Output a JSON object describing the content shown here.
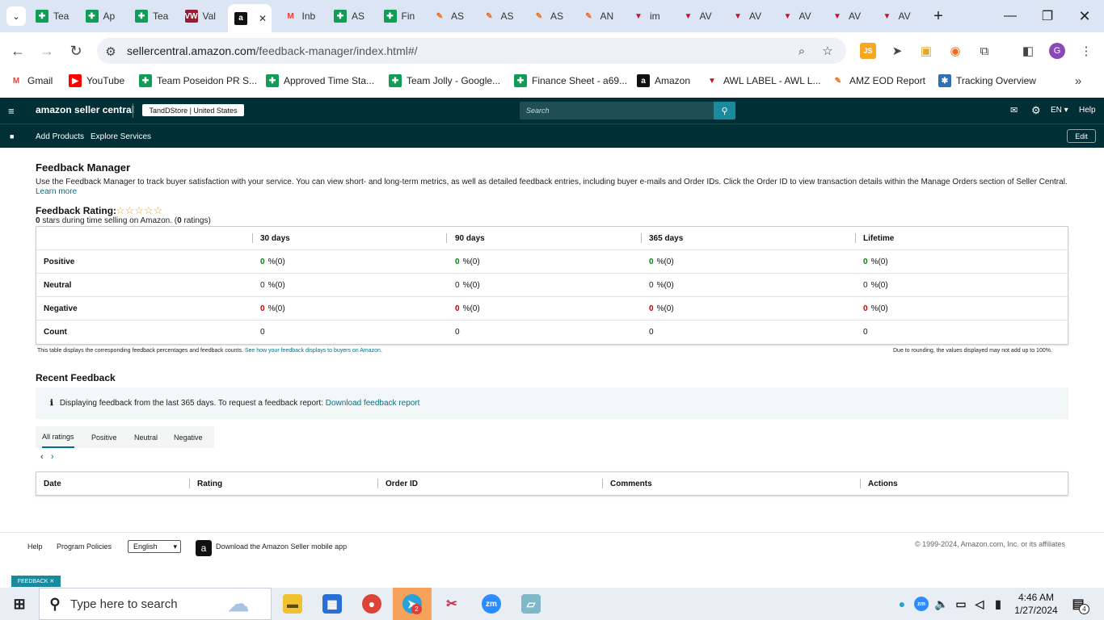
{
  "browser": {
    "tabs": [
      {
        "label": "Tea",
        "icon": "sheets-icon",
        "color": "#0f9d58"
      },
      {
        "label": "Ap",
        "icon": "sheets-icon",
        "color": "#0f9d58"
      },
      {
        "label": "Tea",
        "icon": "sheets-icon",
        "color": "#0f9d58"
      },
      {
        "label": "Val",
        "icon": "vw-icon",
        "color": "#9b1c31"
      },
      {
        "label": "",
        "icon": "amazon-icon",
        "color": "#111111"
      },
      {
        "label": "Inb",
        "icon": "gmail-icon",
        "color": "#ea4335"
      },
      {
        "label": "AS",
        "icon": "sheets-icon",
        "color": "#0f9d58"
      },
      {
        "label": "Fin",
        "icon": "sheets-icon",
        "color": "#0f9d58"
      },
      {
        "label": "AS",
        "icon": "pencil-icon",
        "color": "#f26b1d"
      },
      {
        "label": "AS",
        "icon": "pencil-icon",
        "color": "#f26b1d"
      },
      {
        "label": "AS",
        "icon": "pencil-icon",
        "color": "#f26b1d"
      },
      {
        "label": "AN",
        "icon": "pencil-icon",
        "color": "#f26b1d"
      },
      {
        "label": "im",
        "icon": "awl-icon",
        "color": "#c8102e"
      },
      {
        "label": "AV",
        "icon": "awl-icon",
        "color": "#c8102e"
      },
      {
        "label": "AV",
        "icon": "awl-icon",
        "color": "#c8102e"
      },
      {
        "label": "AV",
        "icon": "awl-icon",
        "color": "#c8102e"
      },
      {
        "label": "AV",
        "icon": "awl-icon",
        "color": "#c8102e"
      },
      {
        "label": "AV",
        "icon": "awl-icon",
        "color": "#c8102e"
      }
    ],
    "url_host": "sellercentral.amazon.com",
    "url_path": "/feedback-manager/index.html#/",
    "profile_initial": "G",
    "bookmarks": [
      {
        "label": "Gmail",
        "icon": "gmail-icon",
        "color": "#ea4335"
      },
      {
        "label": "YouTube",
        "icon": "youtube-icon",
        "color": "#ff0000"
      },
      {
        "label": "Team Poseidon PR S...",
        "icon": "sheets-icon",
        "color": "#0f9d58"
      },
      {
        "label": "Approved Time Sta...",
        "icon": "sheets-icon",
        "color": "#0f9d58"
      },
      {
        "label": "Team Jolly - Google...",
        "icon": "sheets-icon",
        "color": "#0f9d58"
      },
      {
        "label": "Finance Sheet - a69...",
        "icon": "sheets-icon",
        "color": "#0f9d58"
      },
      {
        "label": "Amazon",
        "icon": "amazon-icon",
        "color": "#111111"
      },
      {
        "label": "AWL LABEL - AWL L...",
        "icon": "awl-icon",
        "color": "#c8102e"
      },
      {
        "label": "AMZ EOD Report",
        "icon": "pencil-icon",
        "color": "#f26b1d"
      },
      {
        "label": "Tracking Overview",
        "icon": "tracking-icon",
        "color": "#2f6fb3"
      }
    ]
  },
  "sc": {
    "logo": "amazon seller central",
    "store": "TandDStore | United States",
    "search_placeholder": "Search",
    "lang": "EN",
    "help": "Help",
    "nav": [
      "Add Products",
      "Explore Services"
    ],
    "edit": "Edit"
  },
  "page": {
    "title": "Feedback Manager",
    "description": "Use the Feedback Manager to track buyer satisfaction with your service. You can view short- and long-term metrics, as well as detailed feedback entries, including buyer e-mails and Order IDs. Click the Order ID to view transaction details within the Manage Orders section of Seller Central.",
    "learn_more": "Learn more",
    "rating_label": "Feedback Rating:",
    "rating_stars": "☆☆☆☆☆",
    "rating_value": "0",
    "rating_sub": "stars during time selling on Amazon. (",
    "rating_count": "0",
    "rating_count_suffix": "ratings)",
    "table": {
      "columns": [
        "30 days",
        "90 days",
        "365 days",
        "Lifetime"
      ],
      "rows": [
        {
          "label": "Positive",
          "cells": [
            "0",
            "0",
            "0",
            "0"
          ],
          "suffix": "%(0)",
          "tone": "g"
        },
        {
          "label": "Neutral",
          "cells": [
            "0",
            "0",
            "0",
            "0"
          ],
          "suffix": "%(0)",
          "tone": "k"
        },
        {
          "label": "Negative",
          "cells": [
            "0",
            "0",
            "0",
            "0"
          ],
          "suffix": "%(0)",
          "tone": "r"
        },
        {
          "label": "Count",
          "cells": [
            "0",
            "0",
            "0",
            "0"
          ],
          "suffix": "",
          "tone": "k"
        }
      ]
    },
    "note_left": "This table displays the corresponding feedback percentages and feedback counts.",
    "note_left_link": "See how your feedback displays to buyers on Amazon.",
    "note_right": "Due to rounding, the values displayed may not add up to 100%.",
    "recent_title": "Recent Feedback",
    "info_text": "Displaying feedback from the last 365 days. To request a feedback report:",
    "info_link": "Download feedback report",
    "rating_tabs": [
      "All ratings",
      "Positive",
      "Neutral",
      "Negative"
    ],
    "recent_columns": [
      "Date",
      "Rating",
      "Order ID",
      "Comments",
      "Actions"
    ]
  },
  "footer": {
    "help": "Help",
    "policies": "Program Policies",
    "language": "English",
    "app_text": "Download the Amazon Seller mobile app",
    "copyright": "© 1999-2024, Amazon.com, Inc. or its affiliates",
    "feedback_tab": "FEEDBACK ✕"
  },
  "taskbar": {
    "search_placeholder": "Type here to search",
    "time": "4:46 AM",
    "date": "1/27/2024",
    "notifications": "4",
    "telegram_badge": "2"
  }
}
